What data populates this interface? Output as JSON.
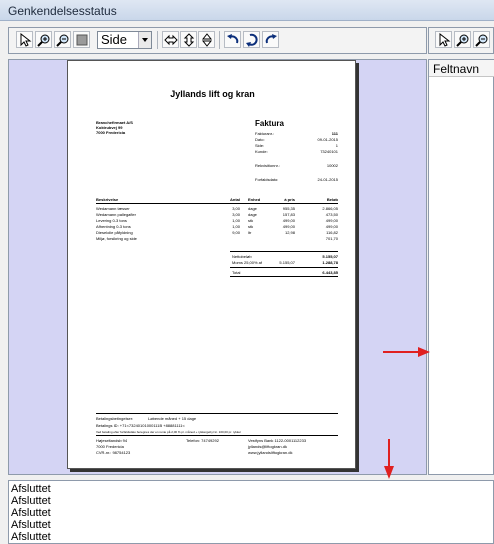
{
  "window": {
    "title": "Genkendelsesstatus"
  },
  "toolbar": {
    "zoom_value": "Side"
  },
  "right_panel": {
    "header": "Feltnavn"
  },
  "status_log": [
    "Afsluttet",
    "Afsluttet",
    "Afsluttet",
    "Afsluttet",
    "Afsluttet"
  ],
  "colors": {
    "viewer_bg": "#d4d4f4",
    "annotation_arrow": "#e02020"
  },
  "document": {
    "company": "Jyllands lift og kran",
    "sender": [
      "Branchefirmaet A/S",
      "Koktrubvej 99",
      "7000 Fredericia"
    ],
    "doc_type": "Faktura",
    "meta": [
      [
        "Fakturanr.:",
        "111"
      ],
      [
        "Dato:",
        "09-01-2015"
      ],
      [
        "Side:",
        "1"
      ],
      [
        "Kunde:",
        "73240101"
      ],
      [
        "Rekvisitionnr.:",
        "10002"
      ],
      [
        "Forfaldsdato:",
        "24-01-2015"
      ]
    ],
    "columns": {
      "desc": "Beskrivelse",
      "qty": "Antal",
      "unit": "Enhed",
      "price": "á pris",
      "amount": "Beløb"
    },
    "lines": [
      {
        "desc": "Wedamann tæsser",
        "qty": "3,00",
        "unit": "dage",
        "price": "955,35",
        "amount": "2.866,05"
      },
      {
        "desc": "Wedamann pallegafler",
        "qty": "3,00",
        "unit": "dage",
        "price": "157,83",
        "amount": "473,50"
      },
      {
        "desc": "Levering 0-3 tons",
        "qty": "1,00",
        "unit": "stk",
        "price": "499,00",
        "amount": "499,00"
      },
      {
        "desc": "Afhentning 0-3 tons",
        "qty": "1,00",
        "unit": "stk",
        "price": "499,00",
        "amount": "499,00"
      },
      {
        "desc": "Dieselolie påfyldning",
        "qty": "9,00",
        "unit": "ltr",
        "price": "12,98",
        "amount": "116,82"
      },
      {
        "desc": "Miljø, forsikring og side",
        "qty": "",
        "unit": "",
        "price": "",
        "amount": "701,70"
      }
    ],
    "totals": {
      "net_label": "Nettobeløb",
      "net": "5.155,07",
      "vat_label": "Moms 25,00% af",
      "vat_base": "5.155,07",
      "vat": "1.288,78",
      "total_label": "Total",
      "total": "6.443,85"
    },
    "payment_terms_label": "Betalingsbetingelser:",
    "payment_terms": "Løbende måned + 15 dage",
    "payment_id": "Betalings ID: +71<73240101000111B +88881111<",
    "small_note": "Ved betaling efter forfaldsdato beregnes der en rente på 2,00 % pr. måned + rykkergebyr kr. 100,00 pr. rykker",
    "footer_left": [
      "Højeseltandsb 94",
      "7000 Fredericia",
      "CVR-nr.:     98754123"
    ],
    "footer_mid": "Telefon:  74749292",
    "footer_right": [
      "Vestfyns Bank          1122-0001112233",
      "jyllands@liftogkran.dk",
      "www.jyllandsliftogkran.dk"
    ]
  }
}
